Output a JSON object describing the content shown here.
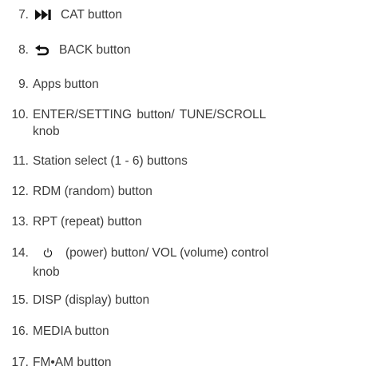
{
  "items": [
    {
      "num": "7.",
      "icon": "skip-forward-icon",
      "label": "CAT button"
    },
    {
      "num": "8.",
      "icon": "back-arrow-icon",
      "label": "BACK button"
    },
    {
      "num": "9.",
      "label": "Apps button"
    },
    {
      "num": "10.",
      "label": "ENTER/SETTING button/ TUNE/SCROLL",
      "continuation": "knob"
    },
    {
      "num": "11.",
      "label": "Station select (1 - 6) buttons"
    },
    {
      "num": "12.",
      "label": "RDM (random) button"
    },
    {
      "num": "13.",
      "label": "RPT (repeat) button"
    },
    {
      "num": "14.",
      "icon": "power-icon",
      "label": "(power) button/ VOL (volume) control",
      "continuation": "knob"
    },
    {
      "num": "15.",
      "label": "DISP (display) button"
    },
    {
      "num": "16.",
      "label": "MEDIA button"
    },
    {
      "num": "17.",
      "label": "FM•AM button"
    }
  ]
}
